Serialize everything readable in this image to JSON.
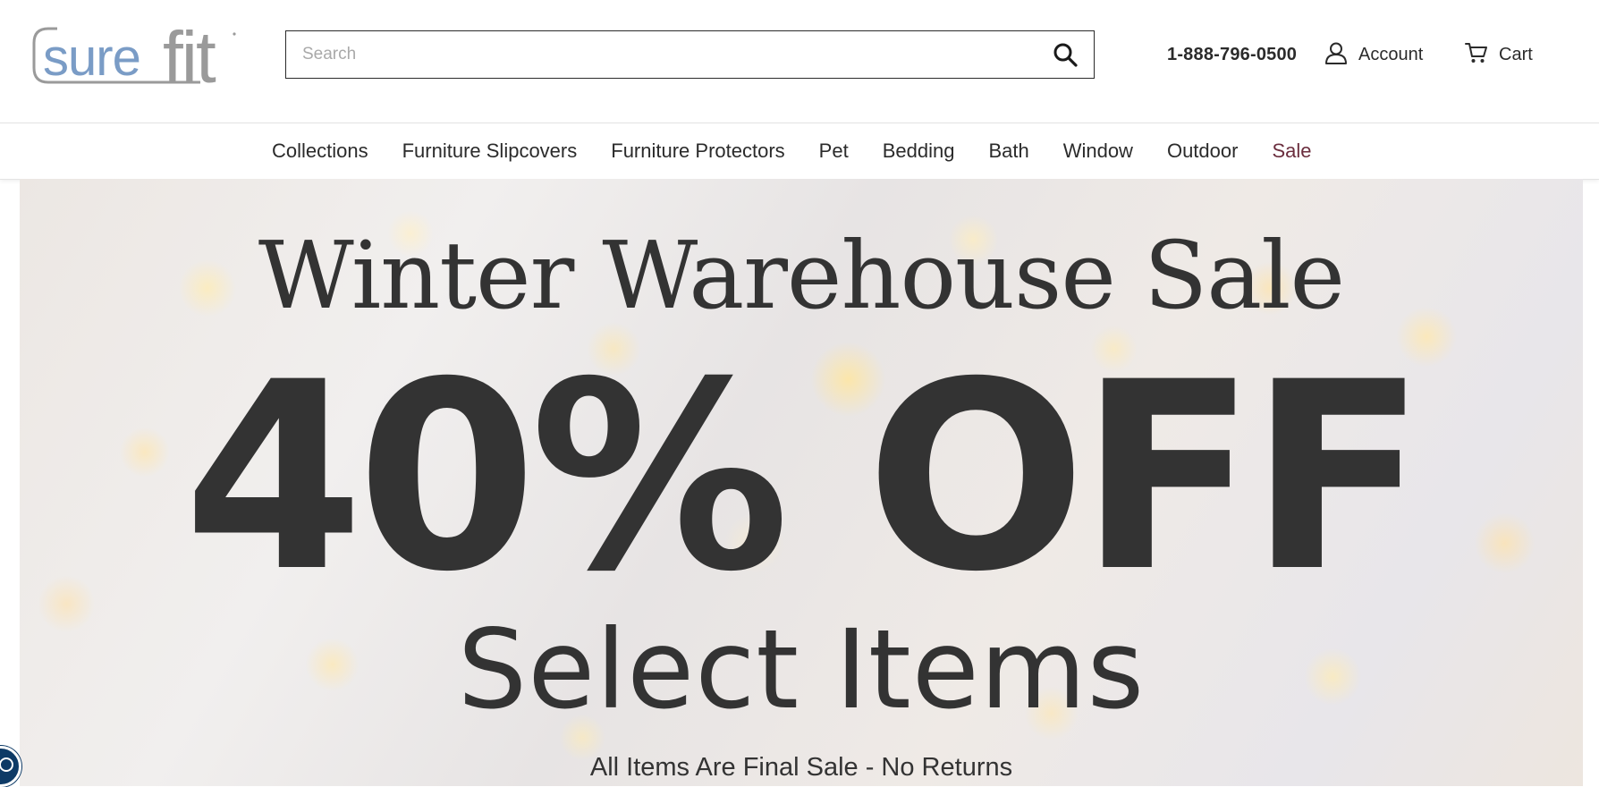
{
  "brand": {
    "logo_text": "surefit",
    "logo_colors": {
      "sure": "#7a9cc6",
      "fit": "#9a9a9a"
    }
  },
  "header": {
    "search": {
      "placeholder": "Search",
      "value": "",
      "icon": "search-icon"
    },
    "phone": "1-888-796-0500",
    "account": {
      "label": "Account",
      "icon": "user-icon"
    },
    "cart": {
      "label": "Cart",
      "icon": "cart-icon"
    }
  },
  "nav": {
    "items": [
      {
        "label": "Collections"
      },
      {
        "label": "Furniture Slipcovers"
      },
      {
        "label": "Furniture Protectors"
      },
      {
        "label": "Pet"
      },
      {
        "label": "Bedding"
      },
      {
        "label": "Bath"
      },
      {
        "label": "Window"
      },
      {
        "label": "Outdoor"
      },
      {
        "label": "Sale",
        "color": "#6b2e3e"
      }
    ]
  },
  "hero": {
    "title": "Winter Warehouse Sale",
    "discount": "40% OFF",
    "subtitle": "Select Items",
    "note": "All Items Are Final Sale - No Returns",
    "text_color": "#333333"
  },
  "accessibility_widget": {
    "icon": "accessibility-icon",
    "color": "#0d3a66"
  }
}
